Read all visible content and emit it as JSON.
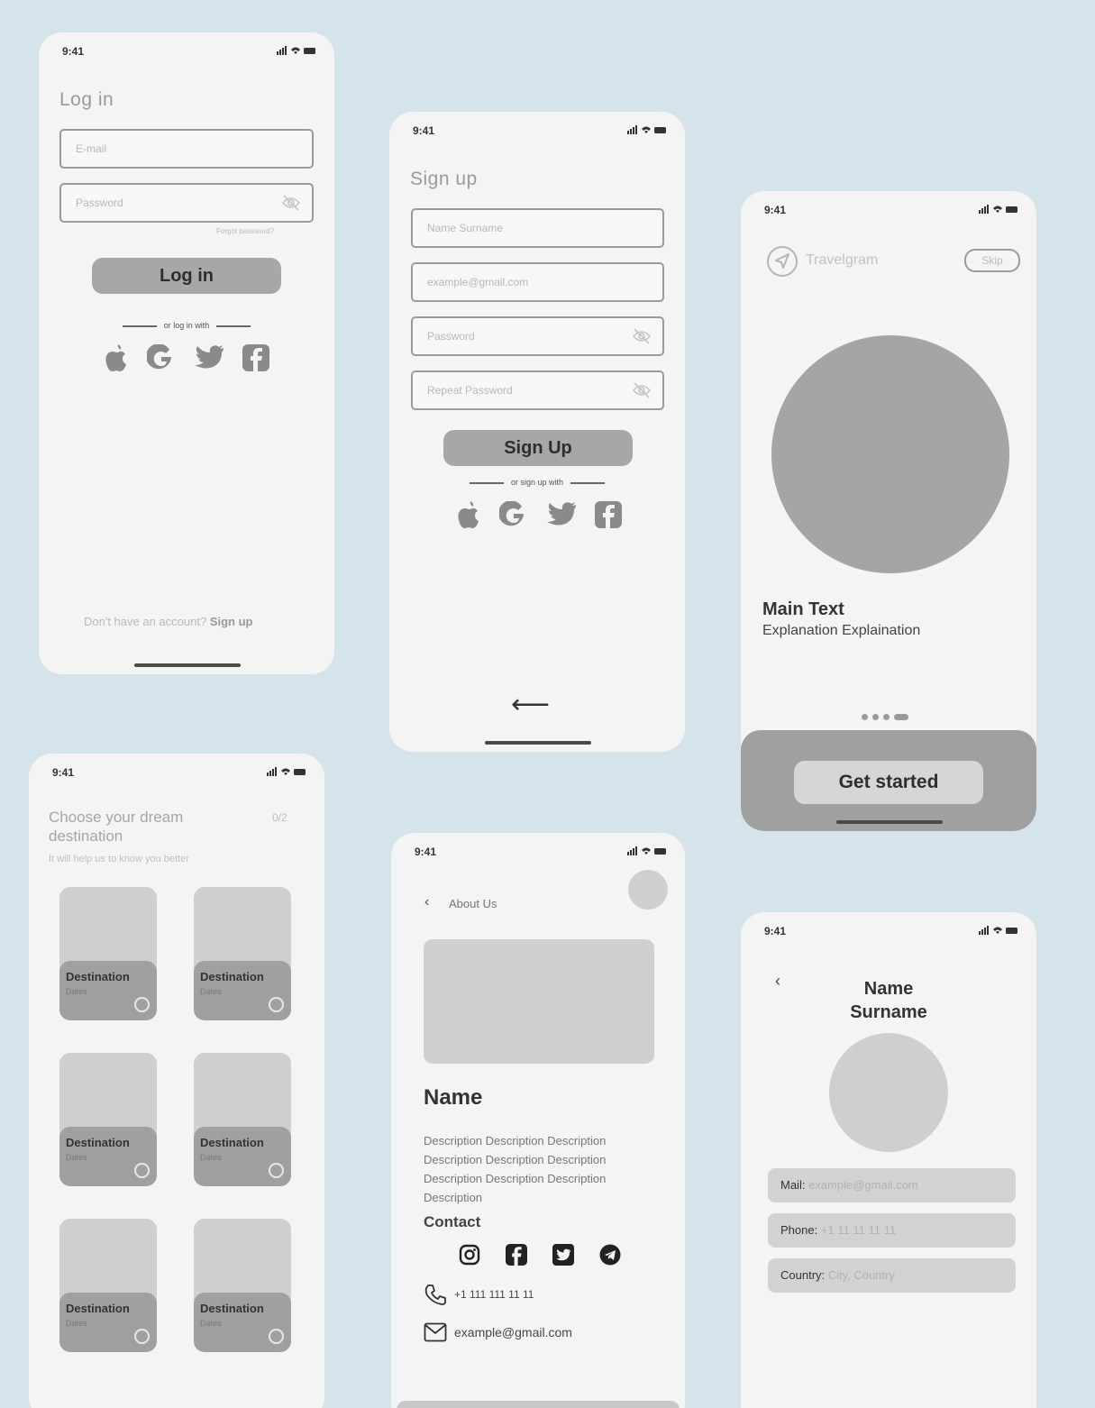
{
  "status": {
    "time": "9:41"
  },
  "login": {
    "title": "Log in",
    "email_placeholder": "E-mail",
    "password_placeholder": "Password",
    "forgot": "Forgot password?",
    "button": "Log in",
    "divider": "or log in with",
    "footer_prefix": "Don't have an account? ",
    "footer_link": "Sign up"
  },
  "signup": {
    "title": "Sign up",
    "name_placeholder": "Name Surname",
    "email_placeholder": "example@gmail.com",
    "password_placeholder": "Password",
    "repeat_placeholder": "Repeat Password",
    "button": "Sign Up",
    "divider": "or sign up with",
    "back_arrow": "⟵"
  },
  "onboarding": {
    "brand": "Travelgram",
    "skip": "Skip",
    "main_text": "Main Text",
    "explanation": "Explanation Explaination",
    "button": "Get started",
    "page_dots": 4,
    "active_dot": 4
  },
  "destinations": {
    "title": "Choose your dream destination",
    "counter": "0/2",
    "subtitle": "It will help us to know you better",
    "items": [
      {
        "name": "Destination",
        "dates": "Dates"
      },
      {
        "name": "Destination",
        "dates": "Dates"
      },
      {
        "name": "Destination",
        "dates": "Dates"
      },
      {
        "name": "Destination",
        "dates": "Dates"
      },
      {
        "name": "Destination",
        "dates": "Dates"
      },
      {
        "name": "Destination",
        "dates": "Dates"
      }
    ]
  },
  "about": {
    "back_label": "About Us",
    "name": "Name",
    "description": "Description Description Description Description Description Description Description Description Description Description",
    "contact_title": "Contact",
    "phone": "+1 111 111 11 11",
    "email": "example@gmail.com"
  },
  "profile": {
    "name": "Name Surname",
    "mail_label": "Mail:",
    "mail_value": "example@gmail.com",
    "phone_label": "Phone:",
    "phone_value": "+1 11 11 11 11",
    "country_label": "Country:",
    "country_value": "City, Country"
  },
  "icons": {
    "social": [
      "apple-icon",
      "google-icon",
      "twitter-icon",
      "facebook-icon"
    ],
    "contact_social": [
      "instagram-icon",
      "facebook-icon",
      "twitter-icon",
      "telegram-icon"
    ]
  },
  "colors": {
    "background": "#d5e4ea",
    "screen": "#f4f4f4",
    "button": "#a7a7a7",
    "placeholder_block": "#cfcfcf"
  }
}
